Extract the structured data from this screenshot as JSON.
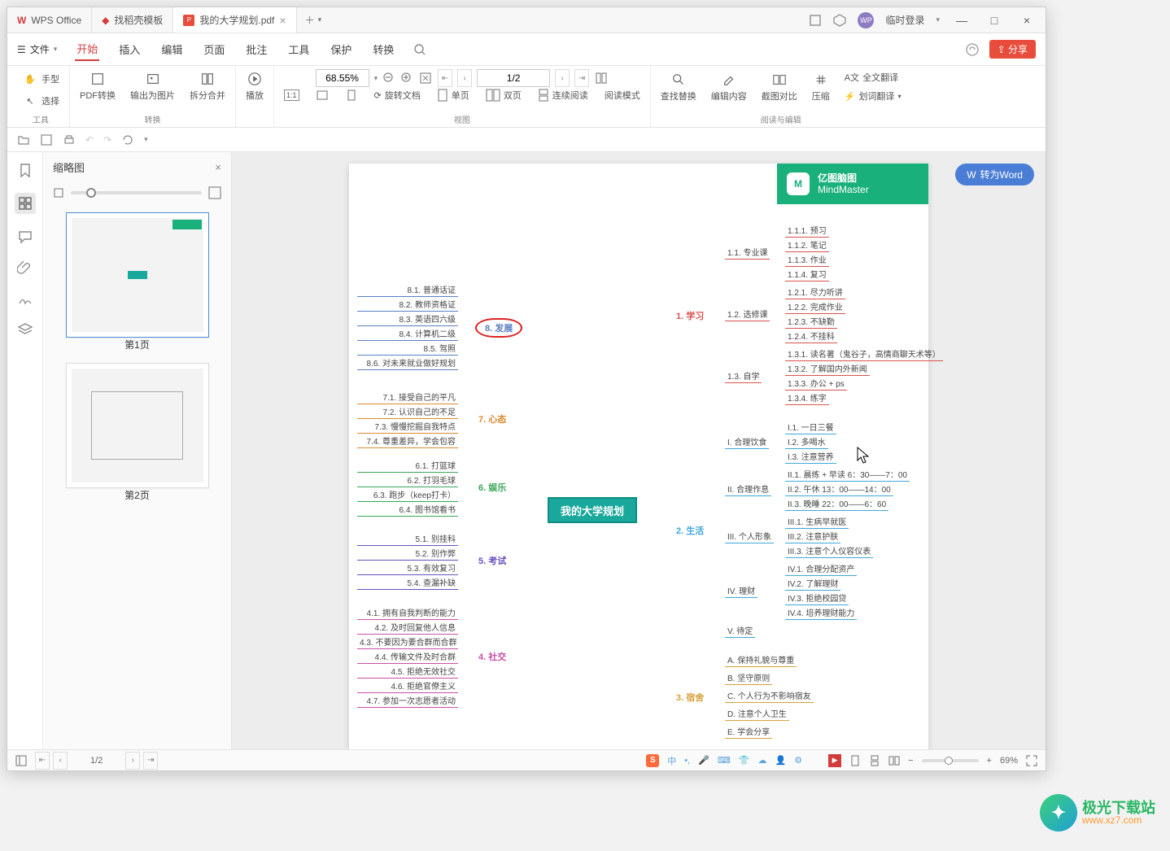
{
  "titlebar": {
    "tabs": [
      {
        "icon": "wps",
        "label": "WPS Office"
      },
      {
        "icon": "template",
        "label": "找稻壳模板"
      },
      {
        "icon": "pdf",
        "label": "我的大学规划.pdf",
        "active": true
      }
    ],
    "login_label": "临时登录"
  },
  "menubar": {
    "file_label": "文件",
    "items": [
      "开始",
      "插入",
      "编辑",
      "页面",
      "批注",
      "工具",
      "保护",
      "转换"
    ],
    "active_index": 0,
    "share_label": "分享"
  },
  "ribbon": {
    "tools": {
      "hand": "手型",
      "select": "选择",
      "group_label": "工具"
    },
    "convert": {
      "pdf_convert": "PDF转换",
      "export_image": "输出为图片",
      "split_merge": "拆分合并",
      "group_label": "转换"
    },
    "play": {
      "label": "播放"
    },
    "zoom_value": "68.55%",
    "page_value": "1/2",
    "view": {
      "fit_page": "适合页面",
      "rotate": "旋转文档",
      "single": "单页",
      "double": "双页",
      "continuous": "连续阅读",
      "read_mode": "阅读模式",
      "group_label": "视图"
    },
    "edit": {
      "find_replace": "查找替换",
      "edit_content": "编辑内容",
      "screenshot_compare": "截图对比",
      "compress": "压缩",
      "full_translate": "全文翻译",
      "word_translate": "划词翻译",
      "group_label": "阅读与编辑"
    }
  },
  "thumbpanel": {
    "title": "缩略图",
    "pages": [
      "第1页",
      "第2页"
    ]
  },
  "to_word_label": "转为Word",
  "mindmaster": {
    "title_cn": "亿图脑图",
    "title_en": "MindMaster"
  },
  "mindmap": {
    "central": "我的大学规划",
    "left": [
      {
        "title": "8. 发展",
        "circled": true,
        "color": "#5a7fc4",
        "children": [
          "8.1. 普通话证",
          "8.2. 教师资格证",
          "8.3. 英语四六级",
          "8.4. 计算机二级",
          "8.5. 驾照",
          "8.6. 对未来就业做好规划"
        ]
      },
      {
        "title": "7. 心态",
        "color": "#d88a2e",
        "children": [
          "7.1. 接受自己的平凡",
          "7.2. 认识自己的不足",
          "7.3. 慢慢挖掘自我特点",
          "7.4. 尊重差异，学会包容"
        ]
      },
      {
        "title": "6. 娱乐",
        "color": "#3aa757",
        "children": [
          "6.1. 打篮球",
          "6.2. 打羽毛球",
          "6.3. 跑步（keep打卡）",
          "6.4. 图书馆看书"
        ]
      },
      {
        "title": "5. 考试",
        "color": "#6a4fbf",
        "children": [
          "5.1. 别挂科",
          "5.2. 别作弊",
          "5.3. 有效复习",
          "5.4. 查漏补缺"
        ]
      },
      {
        "title": "4. 社交",
        "color": "#c94fa8",
        "children": [
          "4.1. 拥有自我判断的能力",
          "4.2. 及时回复他人信息",
          "4.3. 不要因为要合群而合群",
          "4.4. 传输文件及时合群",
          "4.5. 拒绝无效社交",
          "4.6. 拒绝官僚主义",
          "4.7. 参加一次志愿者活动"
        ]
      }
    ],
    "right": [
      {
        "title": "1. 学习",
        "color": "#d9534f",
        "children": [
          {
            "label": "1.1. 专业课",
            "sub": [
              "1.1.1. 预习",
              "1.1.2. 笔记",
              "1.1.3. 作业",
              "1.1.4. 复习"
            ]
          },
          {
            "label": "1.2. 选修课",
            "sub": [
              "1.2.1. 尽力听讲",
              "1.2.2. 完成作业",
              "1.2.3. 不缺勤",
              "1.2.4. 不挂科"
            ]
          },
          {
            "label": "1.3. 自学",
            "sub": [
              "1.3.1. 读名著（鬼谷子，高情商聊天术等）",
              "1.3.2. 了解国内外新闻",
              "1.3.3. 办公 + ps",
              "1.3.4. 练字"
            ]
          }
        ]
      },
      {
        "title": "2. 生活",
        "color": "#3fa8d8",
        "children": [
          {
            "label": "I. 合理饮食",
            "sub": [
              "I.1. 一日三餐",
              "I.2. 多喝水",
              "I.3. 注意营养"
            ]
          },
          {
            "label": "II. 合理作息",
            "sub": [
              "II.1. 晨练 + 早读 6：30——7：00",
              "II.2. 午休 13：00——14：00",
              "II.3. 晚睡 22：00——6：60"
            ]
          },
          {
            "label": "III. 个人形象",
            "sub": [
              "III.1. 生病早就医",
              "III.2. 注意护肤",
              "III.3. 注意个人仪容仪表"
            ]
          },
          {
            "label": "IV. 理财",
            "sub": [
              "IV.1. 合理分配资产",
              "IV.2. 了解理财",
              "IV.3. 拒绝校园贷",
              "IV.4. 培养理财能力"
            ]
          },
          {
            "label": "V. 待定",
            "sub": []
          }
        ]
      },
      {
        "title": "3. 宿舍",
        "color": "#d8a23f",
        "children": [
          {
            "label": "A. 保持礼貌与尊重",
            "sub": []
          },
          {
            "label": "B. 坚守原则",
            "sub": []
          },
          {
            "label": "C. 个人行为不影响宿友",
            "sub": []
          },
          {
            "label": "D. 注意个人卫生",
            "sub": []
          },
          {
            "label": "E. 学会分享",
            "sub": []
          }
        ]
      }
    ]
  },
  "statusbar": {
    "page": "1/2",
    "zoom": "69%"
  },
  "watermark": {
    "name": "极光下载站",
    "url": "www.xz7.com"
  }
}
